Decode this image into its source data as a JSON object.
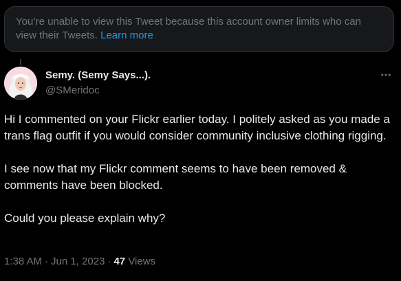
{
  "notice": {
    "text": "You’re unable to view this Tweet because this account owner limits who can view their Tweets.",
    "link": "Learn more"
  },
  "author": {
    "display_name": "Semy. (Semy Says...).",
    "handle": "@SMeridoc"
  },
  "tweet": {
    "paragraphs": [
      "Hi I commented on your Flickr earlier today.  I politely asked as you made a trans flag outfit if you would consider community inclusive clothing rigging.",
      "I see now that my Flickr comment seems to have been removed & comments have been blocked.",
      "Could you please explain why?"
    ]
  },
  "meta": {
    "time": "1:38 AM",
    "date": "Jun 1, 2023",
    "separator": "·",
    "views_count": "47",
    "views_label": "Views"
  },
  "icons": {
    "more": "more-horizontal-icon",
    "avatar": "avatar"
  },
  "colors": {
    "background": "#000000",
    "text_primary": "#e7e9ea",
    "text_secondary": "#71767b",
    "link": "#1d9bf0",
    "notice_bg": "#16181c"
  }
}
